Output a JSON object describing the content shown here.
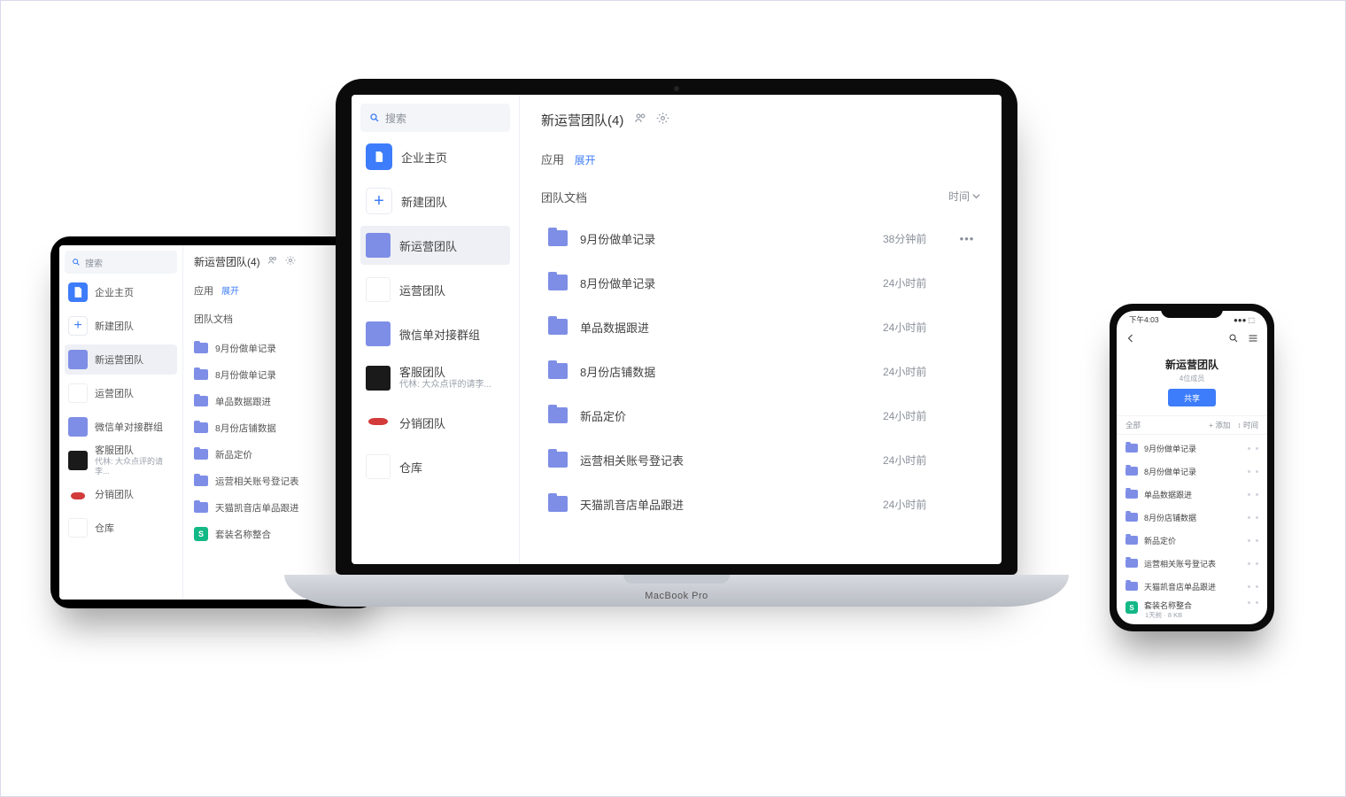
{
  "shared": {
    "search_placeholder": "搜索",
    "home_label": "企业主页",
    "new_team_label": "新建团队",
    "teams": [
      {
        "id": "new-ops",
        "label": "新运营团队",
        "avatar": "blue",
        "sub": ""
      },
      {
        "id": "ops",
        "label": "运营团队",
        "avatar": "white",
        "sub": ""
      },
      {
        "id": "wechat",
        "label": "微信单对接群组",
        "avatar": "blue",
        "sub": ""
      },
      {
        "id": "service",
        "label": "客服团队",
        "avatar": "dark",
        "sub": "代林: 大众点评的请李..."
      },
      {
        "id": "dist",
        "label": "分销团队",
        "avatar": "lips",
        "sub": ""
      },
      {
        "id": "warehouse",
        "label": "仓库",
        "avatar": "white",
        "sub": ""
      }
    ],
    "team_title": "新运营团队(4)",
    "apps_label": "应用",
    "expand_label": "展开",
    "team_docs_label": "团队文档",
    "sort_label": "时间",
    "docs": [
      {
        "name": "9月份做单记录",
        "time": "38分钟前",
        "type": "folder"
      },
      {
        "name": "8月份做单记录",
        "time": "24小时前",
        "type": "folder"
      },
      {
        "name": "单品数据跟进",
        "time": "24小时前",
        "type": "folder"
      },
      {
        "name": "8月份店铺数据",
        "time": "24小时前",
        "type": "folder"
      },
      {
        "name": "新品定价",
        "time": "24小时前",
        "type": "folder"
      },
      {
        "name": "运营相关账号登记表",
        "time": "24小时前",
        "type": "folder"
      },
      {
        "name": "天猫凯音店单品跟进",
        "time": "24小时前",
        "type": "folder"
      },
      {
        "name": "套装名称整合",
        "time": "",
        "type": "sheet"
      }
    ]
  },
  "phone": {
    "time": "下午4:03",
    "sub": "4位成员",
    "share": "共享",
    "tab": "全部",
    "add": "添加",
    "sort": "时间",
    "last_meta": "1天前 · 8 KB"
  },
  "mac_base": "MacBook Pro",
  "sheet_glyph": "S",
  "plus": "+"
}
